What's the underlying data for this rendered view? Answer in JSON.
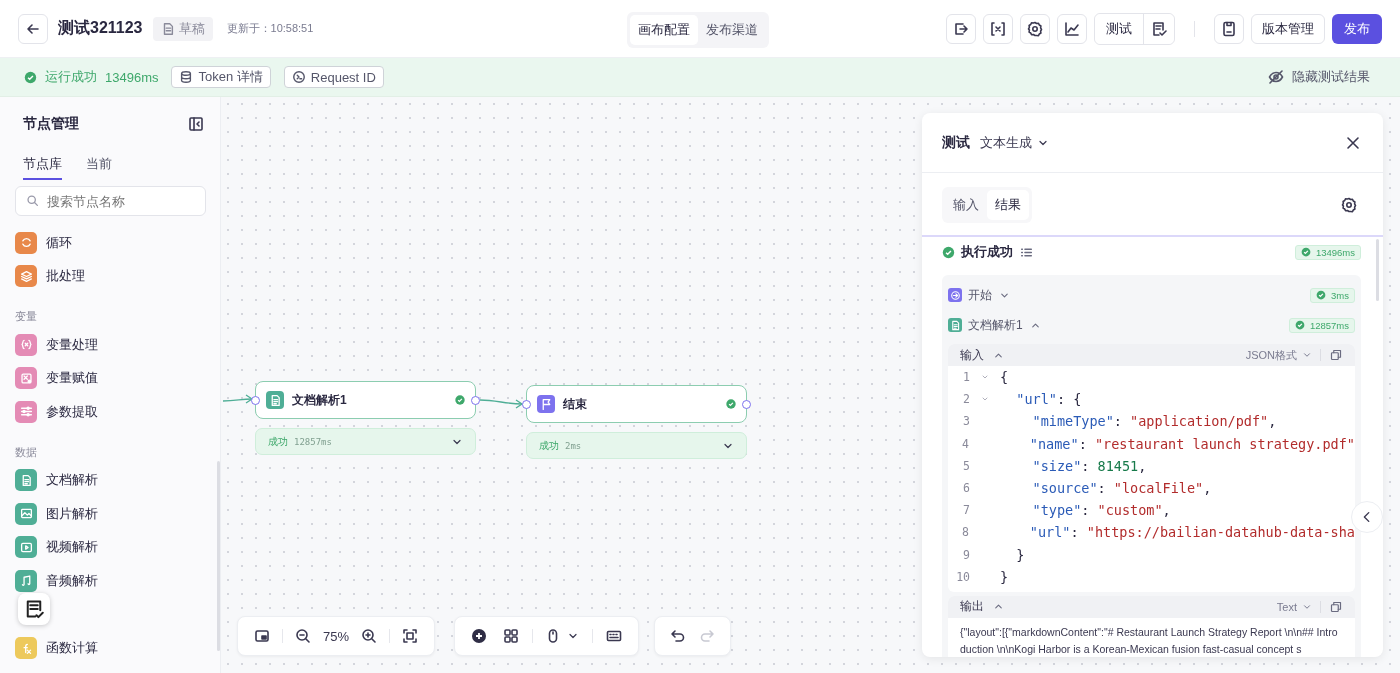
{
  "header": {
    "title": "测试321123",
    "draft_badge": "草稿",
    "updated": "更新于：10:58:51",
    "view_tabs": [
      {
        "label": "画布配置",
        "selected": true
      },
      {
        "label": "发布渠道",
        "selected": false
      }
    ],
    "test_button": "测试",
    "version_button": "版本管理",
    "publish_button": "发布"
  },
  "run_bar": {
    "status": "运行成功",
    "duration": "13496ms",
    "token_button": "Token 详情",
    "request_button": "Request ID",
    "hide_button": "隐藏测试结果"
  },
  "sidebar": {
    "title": "节点管理",
    "tabs": [
      {
        "label": "节点库",
        "selected": true
      },
      {
        "label": "当前",
        "selected": false
      }
    ],
    "search": {
      "placeholder": "搜索节点名称"
    },
    "groups": [
      {
        "items": [
          {
            "name": "循环",
            "kind": "loop",
            "color": "#e8884a"
          },
          {
            "name": "批处理",
            "kind": "layers",
            "color": "#e8884a"
          }
        ]
      },
      {
        "label": "变量",
        "items": [
          {
            "name": "变量处理",
            "kind": "braces",
            "color": "#e48bb5"
          },
          {
            "name": "变量赋值",
            "kind": "variable-edit",
            "color": "#e48bb5"
          },
          {
            "name": "参数提取",
            "kind": "sliders",
            "color": "#e48bb5"
          }
        ]
      },
      {
        "label": "数据",
        "items": [
          {
            "name": "文档解析",
            "kind": "document",
            "color": "#4fae96"
          },
          {
            "name": "图片解析",
            "kind": "image",
            "color": "#4fae96"
          },
          {
            "name": "视频解析",
            "kind": "video",
            "color": "#4fae96"
          },
          {
            "name": "音频解析",
            "kind": "music-note",
            "color": "#4fae96"
          }
        ]
      },
      {
        "items": [
          {
            "name": "函数计算",
            "kind": "function",
            "color": "#edc95c"
          }
        ]
      }
    ]
  },
  "canvas": {
    "nodes": [
      {
        "title": "文档解析1",
        "kind": "document",
        "color": "#4fae96",
        "done": true,
        "status": "成功",
        "duration": "12857ms"
      },
      {
        "title": "结束",
        "kind": "flag",
        "color": "#7d72ee",
        "done": true,
        "status": "成功",
        "duration": "2ms"
      }
    ],
    "zoom": "75%"
  },
  "test_panel": {
    "title": "测试",
    "workflow": "文本生成",
    "tabs": [
      {
        "label": "输入",
        "selected": false
      },
      {
        "label": "结果",
        "selected": true
      }
    ],
    "result": {
      "status": "执行成功",
      "duration": "13496ms"
    },
    "steps": [
      {
        "name": "开始",
        "kind": "start",
        "color": "#7d72ee",
        "duration": "3ms",
        "expanded": false
      },
      {
        "name": "文档解析1",
        "kind": "document",
        "color": "#4fae96",
        "duration": "12857ms",
        "expanded": true
      }
    ],
    "input": {
      "label": "输入",
      "format": "JSON格式",
      "expanded": true,
      "lines": [
        {
          "number": "1",
          "fold": true,
          "tokens": [
            {
              "kind": "punct",
              "text": "{"
            }
          ]
        },
        {
          "number": "2",
          "fold": true,
          "tokens": [
            {
              "kind": "key",
              "text": "  \"url\""
            },
            {
              "kind": "punct",
              "text": ": {"
            }
          ]
        },
        {
          "number": "3",
          "fold": false,
          "tokens": [
            {
              "kind": "key",
              "text": "    \"mimeType\""
            },
            {
              "kind": "punct",
              "text": ": "
            },
            {
              "kind": "string",
              "text": "\"application/pdf\""
            },
            {
              "kind": "punct",
              "text": ","
            }
          ]
        },
        {
          "number": "4",
          "fold": false,
          "tokens": [
            {
              "kind": "key",
              "text": "    \"name\""
            },
            {
              "kind": "punct",
              "text": ": "
            },
            {
              "kind": "string",
              "text": "\"restaurant launch strategy.pdf\""
            }
          ]
        },
        {
          "number": "5",
          "fold": false,
          "tokens": [
            {
              "kind": "key",
              "text": "    \"size\""
            },
            {
              "kind": "punct",
              "text": ": "
            },
            {
              "kind": "number",
              "text": "81451"
            },
            {
              "kind": "punct",
              "text": ","
            }
          ]
        },
        {
          "number": "6",
          "fold": false,
          "tokens": [
            {
              "kind": "key",
              "text": "    \"source\""
            },
            {
              "kind": "punct",
              "text": ": "
            },
            {
              "kind": "string",
              "text": "\"localFile\""
            },
            {
              "kind": "punct",
              "text": ","
            }
          ]
        },
        {
          "number": "7",
          "fold": false,
          "tokens": [
            {
              "kind": "key",
              "text": "    \"type\""
            },
            {
              "kind": "punct",
              "text": ": "
            },
            {
              "kind": "string",
              "text": "\"custom\""
            },
            {
              "kind": "punct",
              "text": ","
            }
          ]
        },
        {
          "number": "8",
          "fold": false,
          "tokens": [
            {
              "kind": "key",
              "text": "    \"url\""
            },
            {
              "kind": "punct",
              "text": ": "
            },
            {
              "kind": "string",
              "text": "\"https://bailian-datahub-data-sha"
            }
          ]
        },
        {
          "number": "9",
          "fold": false,
          "tokens": [
            {
              "kind": "punct",
              "text": "  }"
            }
          ]
        },
        {
          "number": "10",
          "fold": false,
          "tokens": [
            {
              "kind": "punct",
              "text": "}"
            }
          ]
        }
      ]
    },
    "output": {
      "label": "输出",
      "format": "Text",
      "expanded": true,
      "text": "{\"layout\":[{\"markdownContent\":\"# Restaurant Launch Strategy Report \\n\\n## Introduction \\n\\nKogi Harbor is a Korean-Mexican fusion fast-casual concept s"
    }
  }
}
